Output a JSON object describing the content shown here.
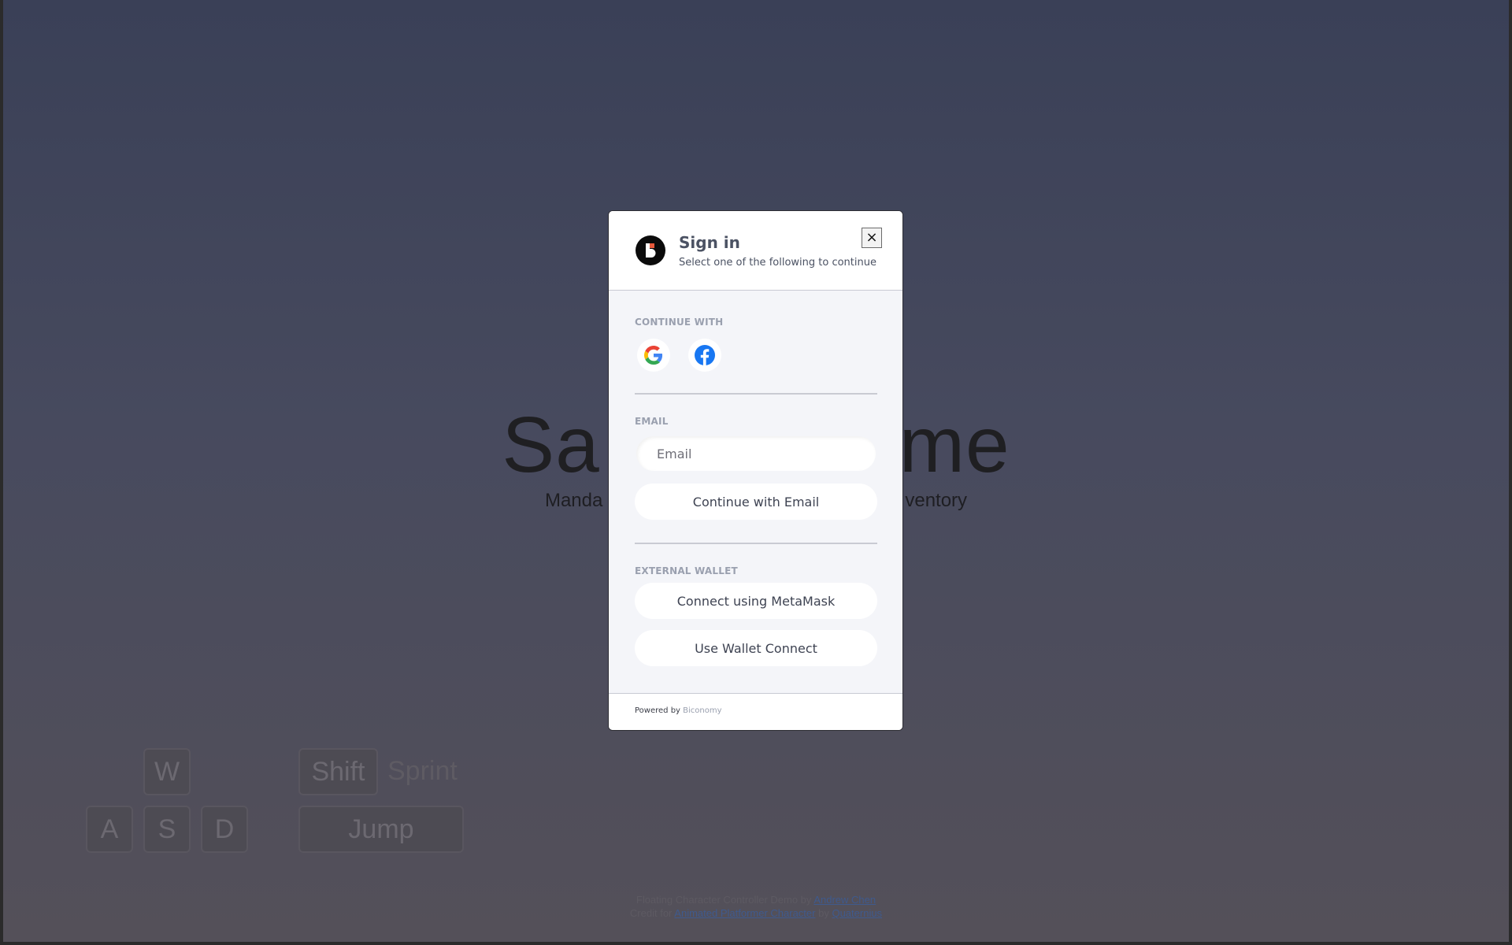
{
  "background": {
    "title": "Sample Game",
    "title_left": "Sa",
    "title_right": "me",
    "subtitle_left": "Manda",
    "subtitle_right": "ventory",
    "keys": {
      "w": "W",
      "a": "A",
      "s": "S",
      "d": "D",
      "shift": "Shift",
      "sprint": "Sprint",
      "jump": "Jump"
    },
    "credits": {
      "line1_prefix": "Floating Character Controller Demo by",
      "line1_author": "Andrew Chen",
      "line2_prefix": "Credit for",
      "line2_asset": "Animated Platformer Character",
      "line2_by": "by",
      "line2_author": "Quaternius"
    }
  },
  "modal": {
    "title": "Sign in",
    "subtitle": "Select one of the following to continue",
    "close_label": "×",
    "continue_with_label": "CONTINUE WITH",
    "social": [
      "google-icon",
      "facebook-icon"
    ],
    "email_label": "EMAIL",
    "email_placeholder": "Email",
    "email_value": "",
    "continue_email_button": "Continue with Email",
    "external_wallet_label": "EXTERNAL WALLET",
    "metamask_button": "Connect using MetaMask",
    "walletconnect_button": "Use Wallet Connect",
    "footer_prefix": "Powered by",
    "footer_brand": "Biconomy"
  },
  "colors": {
    "accent_logo": "#e85a3c",
    "google_blue": "#4285F4",
    "facebook_blue": "#1877F2"
  }
}
